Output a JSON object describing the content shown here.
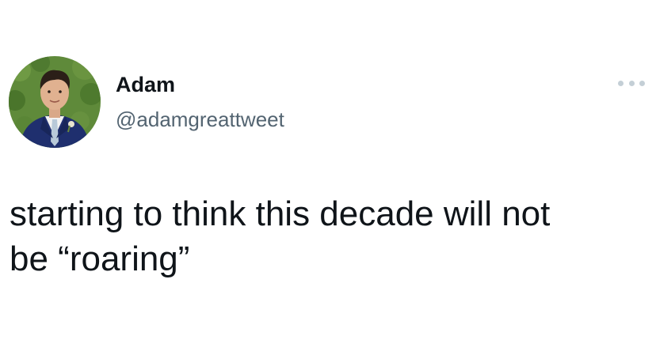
{
  "tweet": {
    "author": {
      "display_name": "Adam",
      "handle": "@adamgreattweet",
      "avatar_icon": "profile-photo"
    },
    "more_icon": "more-options-icon",
    "text_line1": "starting to think this decade will not",
    "text_line2": "be “roaring”"
  },
  "colors": {
    "primary_text": "#0f1419",
    "secondary_text": "#536471",
    "more_dots": "#c4cfd6",
    "background": "#ffffff"
  }
}
